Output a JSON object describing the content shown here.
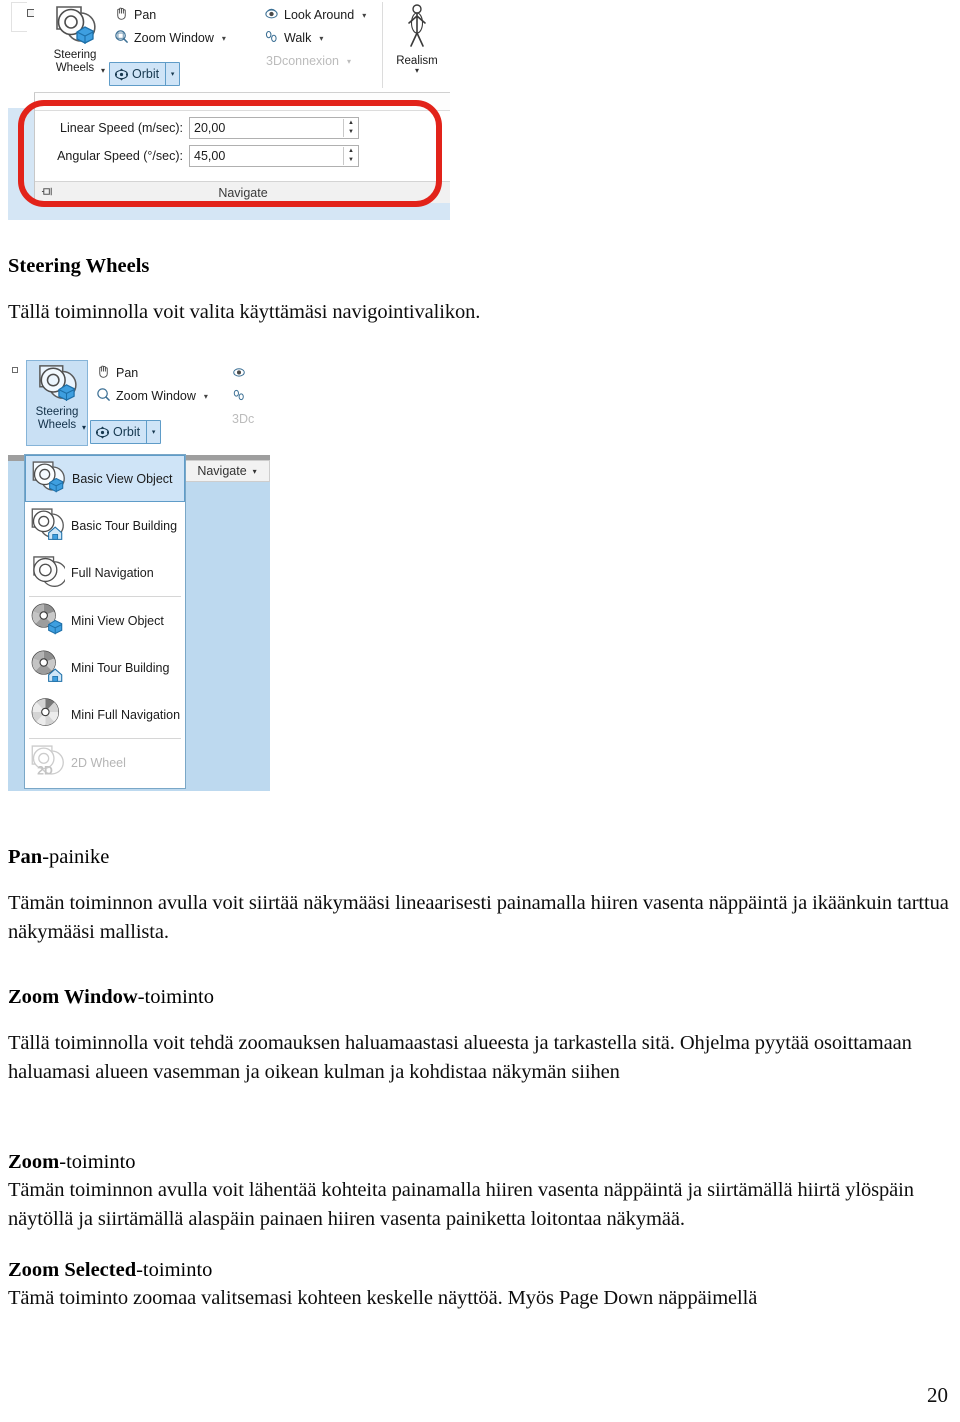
{
  "document": {
    "page_number": "20",
    "sections": [
      {
        "heading_bold": "Steering Wheels",
        "heading_rest": "",
        "body": "Tällä toiminnolla voit valita käyttämäsi navigointivalikon."
      },
      {
        "heading_bold": "Pan",
        "heading_rest": "-painike",
        "body": "Tämän toiminnon avulla voit siirtää näkymääsi lineaarisesti painamalla hiiren vasenta näppäintä ja ikäänkuin tarttua näkymääsi mallista."
      },
      {
        "heading_bold": "Zoom Window",
        "heading_rest": "-toiminto",
        "body": "Tällä toiminnolla voit tehdä zoomauksen haluamaastasi alueesta ja tarkastella sitä. Ohjelma pyytää osoittamaan haluamasi alueen vasemman ja oikean kulman ja kohdistaa näkymän siihen"
      },
      {
        "heading_bold": "Zoom",
        "heading_rest": "-toiminto",
        "body": "Tämän toiminnon avulla voit lähentää kohteita painamalla hiiren vasenta näppäintä ja siirtämällä hiirtä ylöspäin näytöllä ja siirtämällä alaspäin painaen hiiren vasenta painiketta loitontaa näkymää."
      },
      {
        "heading_bold": "Zoom Selected",
        "heading_rest": "-toiminto",
        "body": "Tämä toiminto zoomaa valitsemasi kohteen keskelle näyttöä. Myös Page Down näppäimellä"
      }
    ]
  },
  "screenshot_ribbon": {
    "steering_wheels_button": {
      "label_line1": "Steering",
      "label_line2": "Wheels",
      "caret": "▾"
    },
    "commands": [
      {
        "name": "pan",
        "label": "Pan",
        "dropdown": "",
        "disabled": false
      },
      {
        "name": "zoom-window",
        "label": "Zoom Window",
        "dropdown": "▾",
        "disabled": false
      },
      {
        "name": "look-around",
        "label": "Look Around",
        "dropdown": "▾",
        "disabled": false
      },
      {
        "name": "walk",
        "label": "Walk",
        "dropdown": "▾",
        "disabled": false
      },
      {
        "name": "3dconnexion",
        "label": "3Dconnexion",
        "dropdown": "▾",
        "disabled": true
      }
    ],
    "orbit_button": {
      "label": "Orbit",
      "dropdown": "▾"
    },
    "realism_button": {
      "label": "Realism",
      "caret": "▾"
    },
    "panel": {
      "linear_speed": {
        "label": "Linear Speed (m/sec):",
        "value": "20,00"
      },
      "angular_speed": {
        "label": "Angular Speed (°/sec):",
        "value": "45,00"
      },
      "footer_label": "Navigate",
      "pin_icon": "⌐⊐"
    },
    "highlight_color": "#e2231a"
  },
  "screenshot_menu": {
    "steering_wheels_button": {
      "label_line1": "Steering",
      "label_line2": "Wheels",
      "caret": "▾"
    },
    "commands": [
      {
        "name": "pan",
        "label": "Pan",
        "dropdown": ""
      },
      {
        "name": "zoom-window",
        "label": "Zoom Window",
        "dropdown": "▾"
      }
    ],
    "orbit_button": {
      "label": "Orbit",
      "dropdown": "▾"
    },
    "dim_label": "3Dc",
    "navigate_tab": {
      "label": "Navigate",
      "dropdown": "▾"
    },
    "wheel_items": [
      {
        "name": "basic-view-object",
        "label": "Basic View Object",
        "selected": true,
        "disabled": false,
        "icon": "wheel-view-object-icon"
      },
      {
        "name": "basic-tour-building",
        "label": "Basic Tour Building",
        "selected": false,
        "disabled": false,
        "icon": "wheel-tour-building-icon"
      },
      {
        "name": "full-navigation",
        "label": "Full Navigation",
        "selected": false,
        "disabled": false,
        "icon": "wheel-full-navigation-icon"
      },
      {
        "name": "mini-view-object",
        "label": "Mini View Object",
        "selected": false,
        "disabled": false,
        "icon": "mini-wheel-view-object-icon"
      },
      {
        "name": "mini-tour-building",
        "label": "Mini Tour Building",
        "selected": false,
        "disabled": false,
        "icon": "mini-wheel-tour-building-icon"
      },
      {
        "name": "mini-full-navigation",
        "label": "Mini Full Navigation",
        "selected": false,
        "disabled": false,
        "icon": "mini-wheel-full-navigation-icon"
      },
      {
        "name": "2d-wheel",
        "label": "2D Wheel",
        "selected": false,
        "disabled": true,
        "icon": "wheel-2d-icon"
      }
    ]
  }
}
